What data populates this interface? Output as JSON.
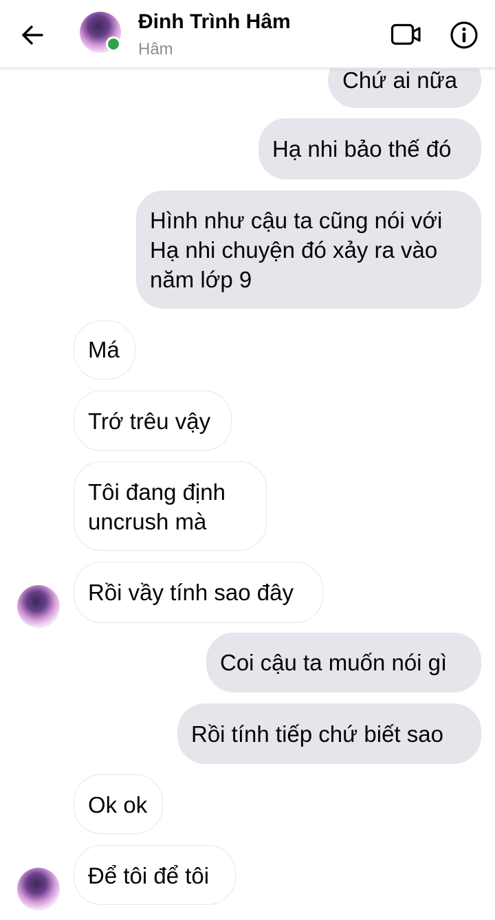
{
  "header": {
    "back_icon": "arrow-left-icon",
    "contact_name": "Đinh Trình Hâm",
    "contact_subtitle": "Hâm",
    "online_status_color": "#31a24c",
    "video_icon": "video-camera-icon",
    "info_icon": "info-icon"
  },
  "colors": {
    "outgoing_bubble": "#e4e6eb",
    "incoming_bubble_border": "#e4e6eb",
    "text": "#050505",
    "subtitle": "#8a8d91"
  },
  "messages": [
    {
      "direction": "outgoing",
      "text": "Chứ ai nữa"
    },
    {
      "direction": "outgoing",
      "text": "Hạ nhi bảo thế đó"
    },
    {
      "direction": "outgoing",
      "lines": [
        "Hình như cậu ta cũng nói với",
        "Hạ nhi chuyện đó xảy ra vào",
        "năm lớp 9"
      ]
    },
    {
      "direction": "incoming",
      "text": "Má"
    },
    {
      "direction": "incoming",
      "text": "Trớ trêu vậy"
    },
    {
      "direction": "incoming",
      "lines": [
        "Tôi đang định",
        "uncrush mà"
      ]
    },
    {
      "direction": "incoming",
      "text": "Rồi vầy tính sao đây",
      "show_avatar": true
    },
    {
      "direction": "outgoing",
      "text": "Coi cậu ta muốn nói gì"
    },
    {
      "direction": "outgoing",
      "text": "Rồi tính tiếp chứ biết sao"
    },
    {
      "direction": "incoming",
      "text": "Ok ok"
    },
    {
      "direction": "incoming",
      "text": "Để tôi để tôi",
      "show_avatar": true
    }
  ]
}
